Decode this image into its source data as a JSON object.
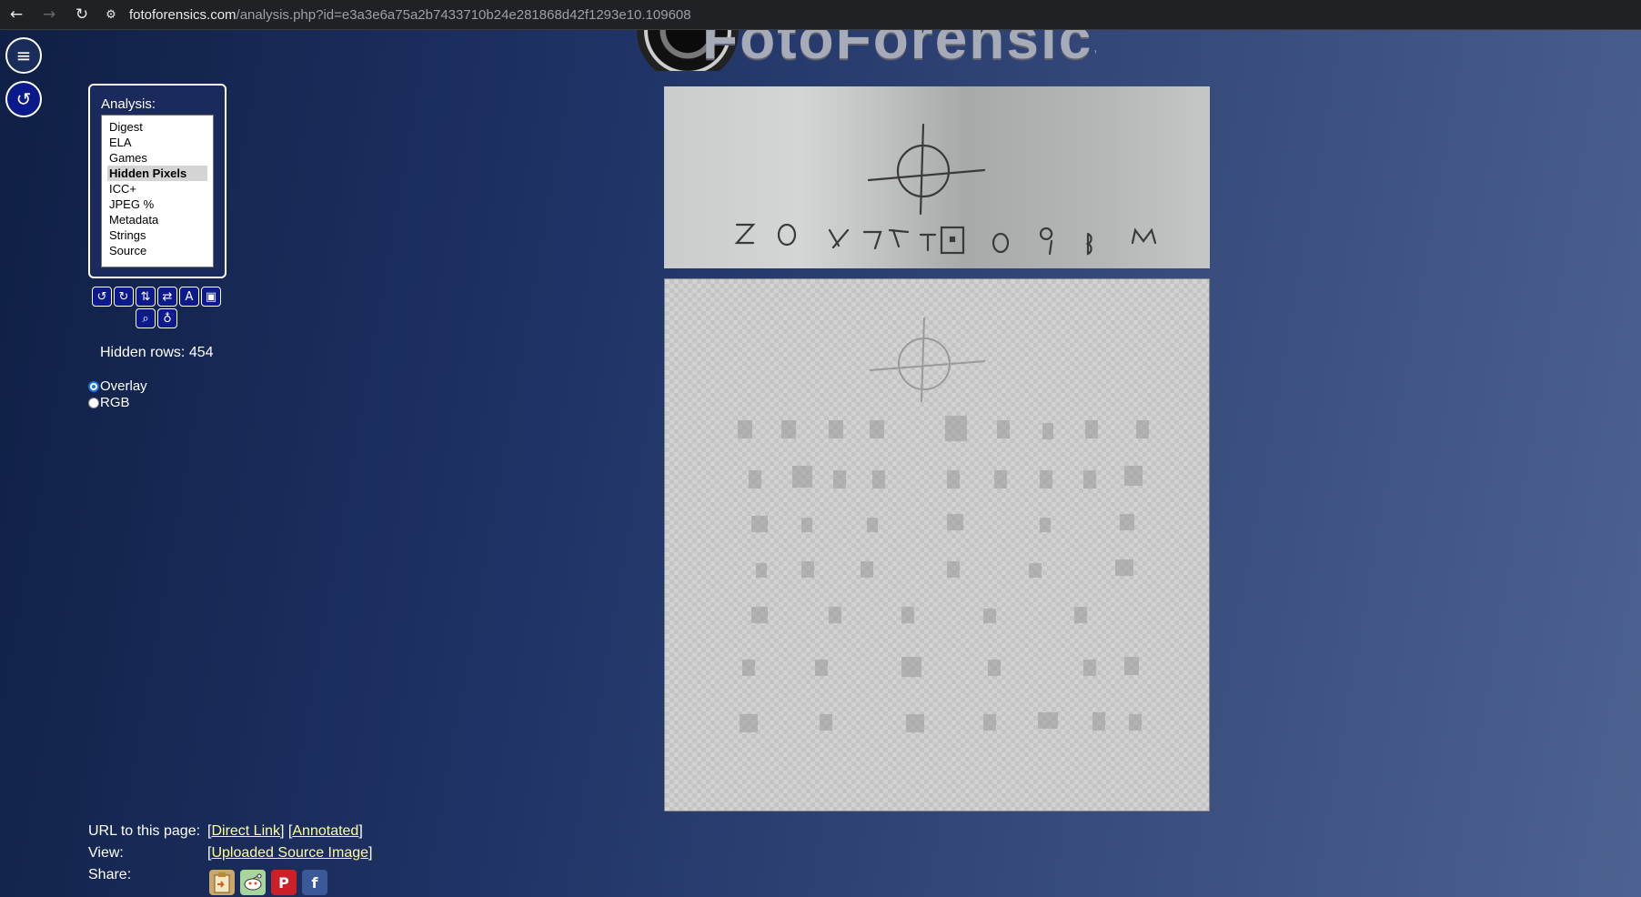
{
  "browser": {
    "url_domain": "fotoforensics.com",
    "url_path": "/analysis.php?id=e3a3e6a75a2b7433710b24e281868d42f1293e10.109608",
    "back_icon": "←",
    "forward_icon": "→",
    "reload_icon": "↻",
    "site_info_icon": "⚙"
  },
  "left_buttons": {
    "menu_icon": "≡",
    "reset_icon": "↺"
  },
  "logo": {
    "text": "FotoForensics"
  },
  "analysis": {
    "label": "Analysis:",
    "items": [
      "Digest",
      "ELA",
      "Games",
      "Hidden Pixels",
      "ICC+",
      "JPEG %",
      "Metadata",
      "Strings",
      "Source"
    ],
    "selected": "Hidden Pixels"
  },
  "tools": {
    "rotate_left": "↺",
    "rotate_right": "↻",
    "flip_vertical": "⇅",
    "flip_horizontal": "⇄",
    "annotate": "A",
    "select": "▣",
    "zoom": "⌕",
    "hint": "♁"
  },
  "hidden_rows": "Hidden rows: 454",
  "view_mode": {
    "options": [
      "Overlay",
      "RGB"
    ],
    "selected": "Overlay"
  },
  "footer": {
    "url_label": "URL to this page:",
    "direct_link": "Direct Link",
    "annotated": "Annotated",
    "view_label": "View:",
    "uploaded_source": "Uploaded Source Image",
    "share_label": "Share:"
  },
  "share_icons": [
    "clipboard-icon",
    "reddit-icon",
    "pinterest-icon",
    "facebook-icon"
  ],
  "colors": {
    "link": "#ffff9e",
    "selected_bg": "#d4d4d4",
    "pinterest": "#cb2027",
    "facebook": "#3b5998"
  }
}
